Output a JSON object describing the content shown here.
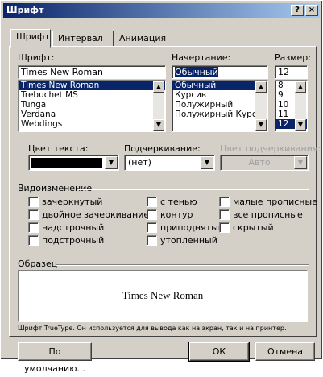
{
  "window": {
    "title": "Шрифт",
    "help_label": "?",
    "close_label": "×"
  },
  "tabs": [
    {
      "label": "Шрифт"
    },
    {
      "label": "Интервал"
    },
    {
      "label": "Анимация"
    }
  ],
  "font": {
    "label": "Шрифт:",
    "value": "Times New Roman",
    "options": [
      "Times New Roman",
      "Trebuchet MS",
      "Tunga",
      "Verdana",
      "Webdings"
    ],
    "selected_index": 0
  },
  "style": {
    "label": "Начертание:",
    "value": "Обычный",
    "options": [
      "Обычный",
      "Курсив",
      "Полужирный",
      "Полужирный Курсив"
    ],
    "selected_index": 0
  },
  "size": {
    "label": "Размер:",
    "value": "12",
    "options": [
      "8",
      "9",
      "10",
      "11",
      "12"
    ],
    "selected_index": 4
  },
  "text_color": {
    "label": "Цвет текста:",
    "swatch": "#000000"
  },
  "underline": {
    "label": "Подчеркивание:",
    "value": "(нет)"
  },
  "underline_color": {
    "label": "Цвет подчеркивания:",
    "value": "Авто"
  },
  "effects": {
    "group_label": "Видоизменение",
    "col1": [
      "зачеркнутый",
      "двойное зачеркивание",
      "надстрочный",
      "подстрочный"
    ],
    "col2": [
      "с тенью",
      "контур",
      "приподнятый",
      "утопленный"
    ],
    "col3": [
      "малые прописные",
      "все прописные",
      "скрытый"
    ]
  },
  "preview": {
    "group_label": "Образец",
    "sample_text": "Times New Roman",
    "description": "Шрифт TrueType. Он используется для вывода как на экран, так и на принтер."
  },
  "buttons": {
    "default": "По умолчанию...",
    "ok": "ОК",
    "cancel": "Отмена"
  }
}
